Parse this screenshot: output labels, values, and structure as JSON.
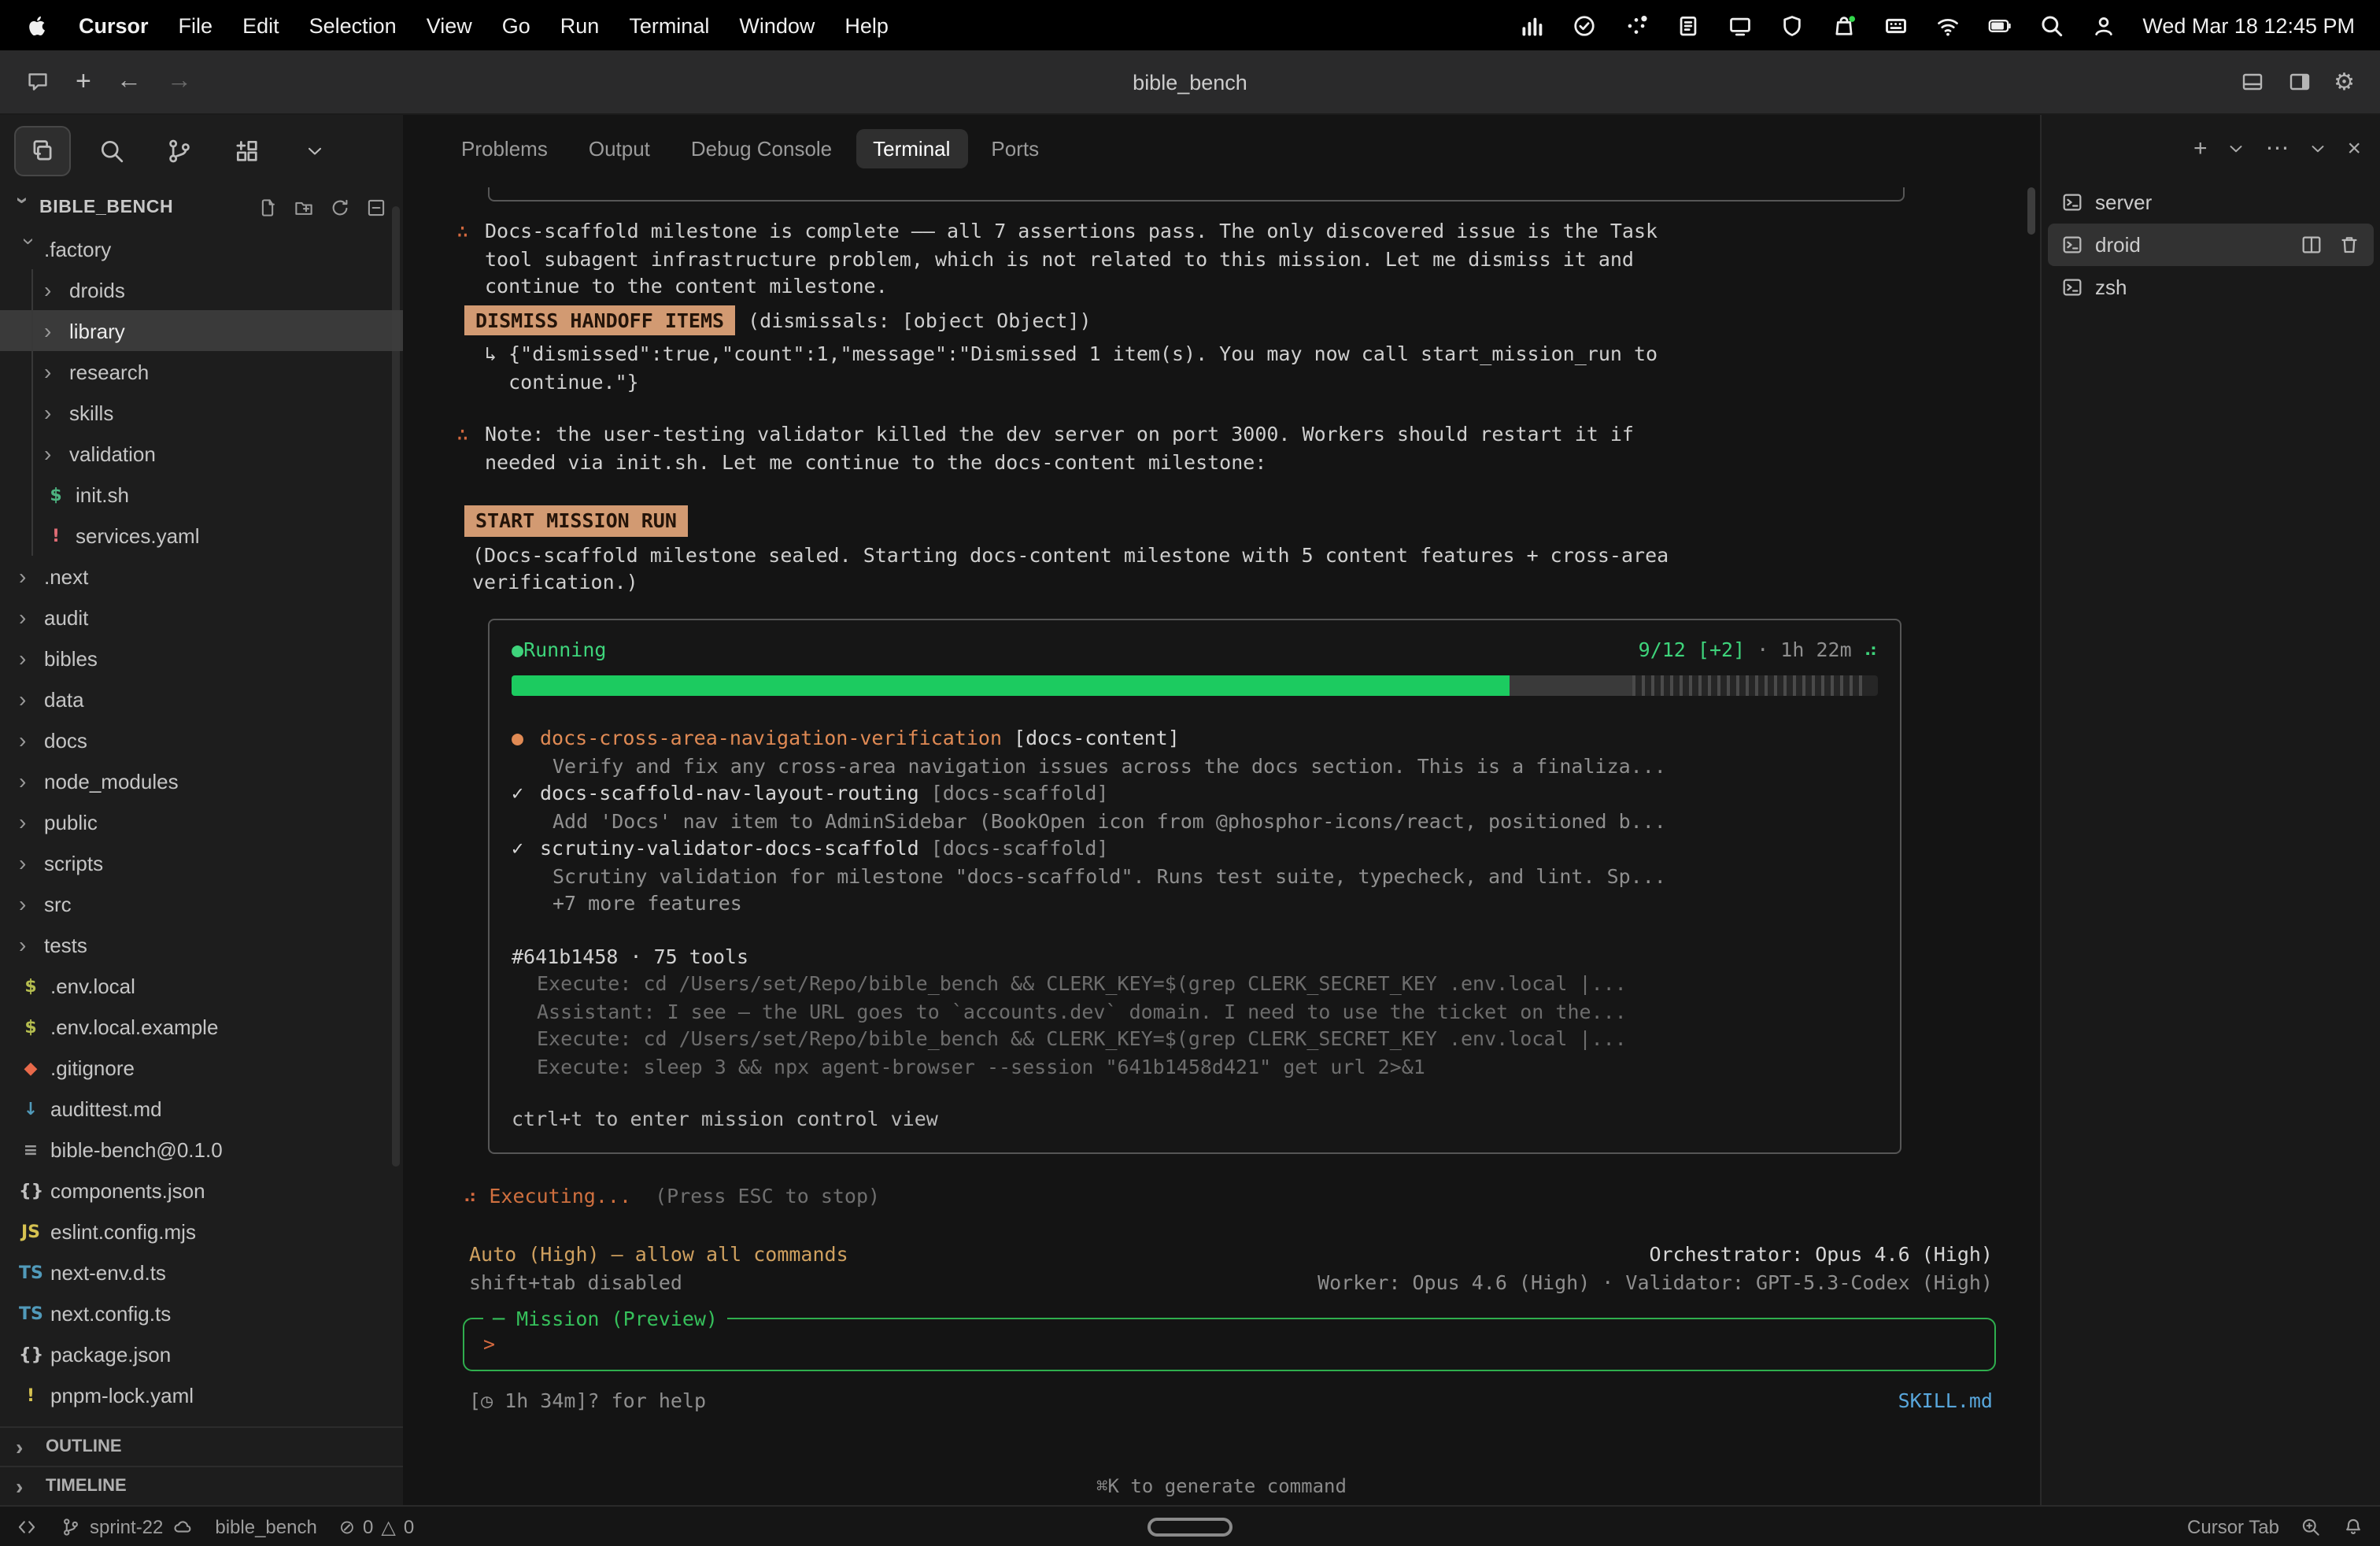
{
  "menubar": {
    "items": [
      "Cursor",
      "File",
      "Edit",
      "Selection",
      "View",
      "Go",
      "Run",
      "Terminal",
      "Window",
      "Help"
    ],
    "status_icons": [
      "stats-icon",
      "check-circle-icon",
      "app-cluster-icon",
      "clipboard-icon",
      "screen-mirror-icon",
      "shield-icon",
      "bag-icon",
      "window-grid-icon",
      "wifi-icon",
      "battery-icon",
      "spotlight-icon",
      "user-icon"
    ],
    "clock": "Wed Mar 18 12:45 PM"
  },
  "titlebar": {
    "title": "bible_bench"
  },
  "explorer": {
    "project": "BIBLE_BENCH",
    "header_actions": [
      "new-file-icon",
      "new-folder-icon",
      "refresh-icon",
      "collapse-all-icon"
    ],
    "activity_icons": [
      "files-icon",
      "search-icon",
      "source-control-icon",
      "extensions-icon",
      "chevron-down-icon"
    ],
    "tree": [
      {
        "label": ".factory",
        "type": "folder",
        "expanded": true,
        "level": 0
      },
      {
        "label": "droids",
        "type": "folder",
        "level": 1
      },
      {
        "label": "library",
        "type": "folder",
        "level": 1,
        "selected": true
      },
      {
        "label": "research",
        "type": "folder",
        "level": 1
      },
      {
        "label": "skills",
        "type": "folder",
        "level": 1
      },
      {
        "label": "validation",
        "type": "folder",
        "level": 1
      },
      {
        "label": "init.sh",
        "type": "file",
        "icon": "$",
        "icon_color": "#4db380",
        "level": 1
      },
      {
        "label": "services.yaml",
        "type": "file",
        "icon": "!",
        "icon_color": "#e06c75",
        "level": 1
      },
      {
        "label": ".next",
        "type": "folder",
        "level": 0
      },
      {
        "label": "audit",
        "type": "folder",
        "level": 0
      },
      {
        "label": "bibles",
        "type": "folder",
        "level": 0
      },
      {
        "label": "data",
        "type": "folder",
        "level": 0
      },
      {
        "label": "docs",
        "type": "folder",
        "level": 0
      },
      {
        "label": "node_modules",
        "type": "folder",
        "level": 0
      },
      {
        "label": "public",
        "type": "folder",
        "level": 0
      },
      {
        "label": "scripts",
        "type": "folder",
        "level": 0
      },
      {
        "label": "src",
        "type": "folder",
        "level": 0
      },
      {
        "label": "tests",
        "type": "folder",
        "level": 0
      },
      {
        "label": ".env.local",
        "type": "file",
        "icon": "$",
        "icon_color": "#b5bd4f",
        "level": 0
      },
      {
        "label": ".env.local.example",
        "type": "file",
        "icon": "$",
        "icon_color": "#b5bd4f",
        "level": 0
      },
      {
        "label": ".gitignore",
        "type": "file",
        "icon": "◆",
        "icon_color": "#e8694a",
        "level": 0
      },
      {
        "label": "audittest.md",
        "type": "file",
        "icon": "↓",
        "icon_color": "#519aba",
        "level": 0
      },
      {
        "label": "bible-bench@0.1.0",
        "type": "file",
        "icon": "≡",
        "icon_color": "#9a9a9a",
        "level": 0
      },
      {
        "label": "components.json",
        "type": "file",
        "icon": "{}",
        "icon_color": "#c0c0c0",
        "level": 0
      },
      {
        "label": "eslint.config.mjs",
        "type": "file",
        "icon": "JS",
        "icon_color": "#d6c251",
        "level": 0
      },
      {
        "label": "next-env.d.ts",
        "type": "file",
        "icon": "TS",
        "icon_color": "#519aba",
        "level": 0
      },
      {
        "label": "next.config.ts",
        "type": "file",
        "icon": "TS",
        "icon_color": "#519aba",
        "level": 0
      },
      {
        "label": "package.json",
        "type": "file",
        "icon": "{}",
        "icon_color": "#c0c0c0",
        "level": 0
      },
      {
        "label": "pnpm-lock.yaml",
        "type": "file",
        "icon": "!",
        "icon_color": "#d6c251",
        "level": 0
      }
    ],
    "bottom_sections": [
      "OUTLINE",
      "TIMELINE"
    ]
  },
  "panel": {
    "tabs": [
      "Problems",
      "Output",
      "Debug Console",
      "Terminal",
      "Ports"
    ],
    "active_tab": "Terminal",
    "bottom_hint": "⌘K to generate command"
  },
  "terminal": {
    "blocks": [
      {
        "type": "boxend"
      },
      {
        "type": "para",
        "marker": "∴",
        "lines": [
          "Docs-scaffold milestone is complete —— all 7 assertions pass. The only discovered issue is the Task",
          "tool subagent infrastructure problem, which is not related to this mission. Let me dismiss it and",
          "continue to the content milestone."
        ]
      },
      {
        "type": "badge",
        "label": "DISMISS HANDOFF ITEMS",
        "after": "(dismissals: [object Object])"
      },
      {
        "type": "lines",
        "lines": [
          "↳ {\"dismissed\":true,\"count\":1,\"message\":\"Dismissed 1 item(s). You may now call start_mission_run to",
          "  continue.\"}"
        ],
        "indent": 18
      },
      {
        "type": "spacer"
      },
      {
        "type": "para",
        "marker": "∴",
        "lines": [
          "Note: the user-testing validator killed the dev server on port 3000. Workers should restart it if",
          "needed via init.sh. Let me continue to the docs-content milestone:"
        ]
      },
      {
        "type": "spacer"
      },
      {
        "type": "badge",
        "label": "START MISSION RUN",
        "after": ""
      },
      {
        "type": "lines",
        "lines": [
          "(Docs-scaffold milestone sealed. Starting docs-content milestone with 5 content features + cross-area",
          "verification.)"
        ],
        "indent": 10
      },
      {
        "type": "runbox",
        "status": "Running",
        "counter": "9/12",
        "extra": "[+2]",
        "elapsed": "· 1h 22m",
        "spinner": "⠴",
        "progress": {
          "green": 73,
          "dark": 9,
          "striped": 17
        },
        "features": [
          {
            "marker": "●",
            "state": "active",
            "title": "docs-cross-area-navigation-verification",
            "tag": "[docs-content]",
            "desc": "Verify and fix any cross-area navigation issues across the docs section. This is a finaliza..."
          },
          {
            "marker": "✓",
            "state": "done",
            "title": "docs-scaffold-nav-layout-routing",
            "tag": "[docs-scaffold]",
            "desc": "Add 'Docs' nav item to AdminSidebar (BookOpen icon from @phosphor-icons/react, positioned b..."
          },
          {
            "marker": "✓",
            "state": "done",
            "title": "scrutiny-validator-docs-scaffold",
            "tag": "[docs-scaffold]",
            "desc": "Scrutiny validation for milestone \"docs-scaffold\". Runs test suite, typecheck, and lint. Sp..."
          }
        ],
        "more": "+7 more features",
        "run_id": "#641b1458 · 75 tools",
        "log": [
          "Execute: cd /Users/set/Repo/bible_bench && CLERK_KEY=$(grep CLERK_SECRET_KEY .env.local |...",
          "Assistant: I see — the URL goes to `accounts.dev` domain. I need to use the ticket on the...",
          "Execute: cd /Users/set/Repo/bible_bench && CLERK_KEY=$(grep CLERK_SECRET_KEY .env.local |...",
          "Execute: sleep 3 && npx agent-browser --session \"641b1458d421\" get url 2>&1"
        ],
        "footer": "ctrl+t to enter mission control view"
      },
      {
        "type": "exec",
        "spinner": "⠴",
        "label": "Executing...",
        "hint": "(Press ESC to stop)"
      },
      {
        "type": "meta",
        "left": "Auto (High) — allow all commands",
        "left_class": "c-amber",
        "right": "Orchestrator: Opus 4.6 (High)",
        "right_class": "c-light",
        "gap_top": true
      },
      {
        "type": "meta",
        "left": "shift+tab disabled",
        "left_class": "c-dim",
        "right": "Worker: Opus 4.6 (High) · Validator: GPT-5.3-Codex (High)",
        "right_class": "c-dim"
      },
      {
        "type": "input",
        "label": "Mission (Preview)",
        "prompt": ">"
      },
      {
        "type": "meta",
        "left": "[◷ 1h 34m]? for help",
        "left_class": "c-dim",
        "right": "SKILL.md",
        "right_class": "c-link",
        "help_row": true
      }
    ]
  },
  "terminal_panel": {
    "actions": [
      "plus-icon",
      "chevron-down-icon",
      "more-icon",
      "chevron-down-icon",
      "close-icon"
    ],
    "items": [
      {
        "label": "server"
      },
      {
        "label": "droid",
        "selected": true,
        "actions": [
          "split-icon",
          "trash-icon"
        ]
      },
      {
        "label": "zsh"
      }
    ]
  },
  "statusbar": {
    "branch": "sprint-22",
    "workspace": "bible_bench",
    "errors": "0",
    "warnings": "0",
    "right_label": "Cursor Tab"
  }
}
